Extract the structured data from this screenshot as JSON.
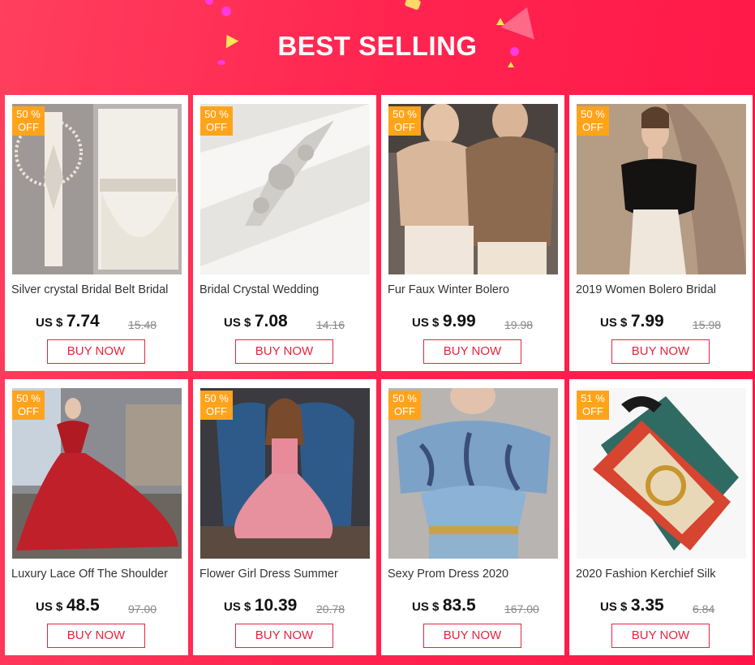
{
  "header": {
    "title": "BEST SELLING"
  },
  "colors": {
    "background": "#ff2550",
    "badge": "#ffa41a",
    "button": "#e8243f"
  },
  "buy_label": "BUY NOW",
  "currency": "US $",
  "products": [
    {
      "badge": "50 % OFF",
      "title": "Silver crystal Bridal Belt Bridal",
      "price": "7.74",
      "old_price": "15.48",
      "image": "crystal-bridal-belt-on-dress"
    },
    {
      "badge": "50 % OFF",
      "title": "Bridal Crystal Wedding",
      "price": "7.08",
      "old_price": "14.16",
      "image": "crystal-applique-sash"
    },
    {
      "badge": "50 % OFF",
      "title": "Fur Faux Winter Bolero",
      "price": "9.99",
      "old_price": "19.98",
      "image": "two-models-fur-wraps"
    },
    {
      "badge": "50 % OFF",
      "title": "2019 Women Bolero Bridal",
      "price": "7.99",
      "old_price": "15.98",
      "image": "model-black-fur-bolero"
    },
    {
      "badge": "50 % OFF",
      "title": "Luxury Lace Off The Shoulder",
      "price": "48.5",
      "old_price": "97.00",
      "image": "red-lace-ball-gown"
    },
    {
      "badge": "50 % OFF",
      "title": "Flower Girl Dress Summer",
      "price": "10.39",
      "old_price": "20.78",
      "image": "girl-pink-tulle-dress"
    },
    {
      "badge": "50 % OFF",
      "title": "Sexy Prom Dress 2020",
      "price": "83.5",
      "old_price": "167.00",
      "image": "blue-sequin-prom-dress"
    },
    {
      "badge": "51 % OFF",
      "title": "2020 Fashion Kerchief Silk",
      "price": "3.35",
      "old_price": "6.84",
      "image": "printed-silk-scarf"
    }
  ]
}
